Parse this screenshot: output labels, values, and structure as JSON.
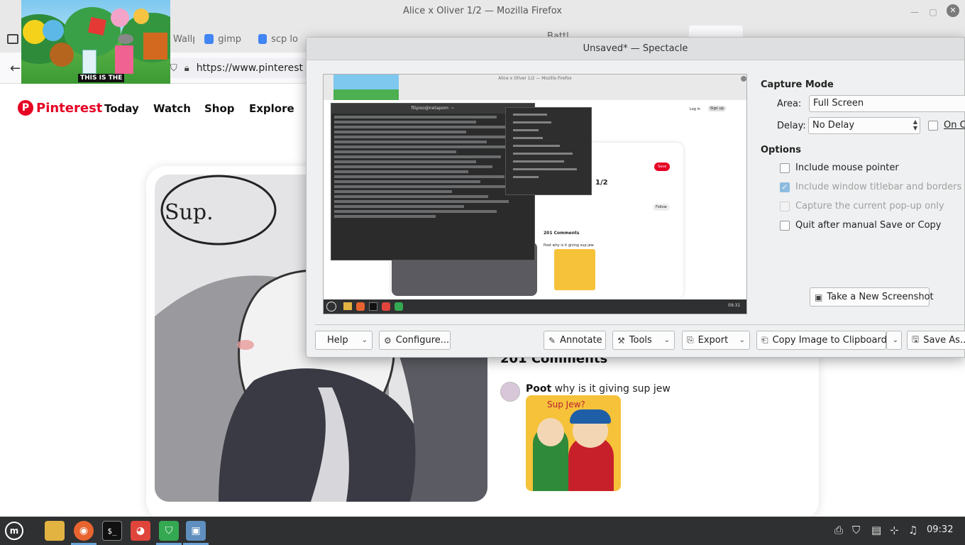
{
  "firefox": {
    "window_title": "Alice x Oliver 1/2 — Mozilla Firefox",
    "tabs": [
      {
        "label": "Wallp"
      },
      {
        "label": "gimp"
      },
      {
        "label": "scp lo"
      },
      {
        "label": "Battl"
      }
    ],
    "url": "https://www.pinterest",
    "thumbnail_caption": "THIS IS THE"
  },
  "pinterest": {
    "logo_text": "Pinterest",
    "nav": [
      "Today",
      "Watch",
      "Shop",
      "Explore"
    ],
    "speech_text": "Sup.",
    "comments_title": "201 Comments",
    "comment": {
      "author": "Poot",
      "text": "why is it giving sup jew"
    },
    "comment_image_text": "Sup Jew?"
  },
  "spectacle": {
    "title": "Unsaved* — Spectacle",
    "capture_mode_heading": "Capture Mode",
    "area_label": "Area:",
    "area_value": "Full Screen",
    "delay_label": "Delay:",
    "delay_value": "No Delay",
    "on_click_label": "On Cl",
    "options_heading": "Options",
    "options": [
      {
        "label": "Include mouse pointer",
        "checked": false,
        "enabled": true
      },
      {
        "label": "Include window titlebar and borders",
        "checked": true,
        "enabled": false
      },
      {
        "label": "Capture the current pop-up only",
        "checked": false,
        "enabled": false
      },
      {
        "label": "Quit after manual Save or Copy",
        "checked": false,
        "enabled": true
      }
    ],
    "take_screenshot_label": "Take a New Screenshot",
    "buttons": {
      "help": "Help",
      "configure": "Configure...",
      "annotate": "Annotate",
      "tools": "Tools",
      "export": "Export",
      "copy": "Copy Image to Clipboard",
      "save": "Save As..."
    },
    "preview": {
      "window_title": "Alice x Oliver 1/2 — Mozilla Firefox",
      "terminal_title": "filipiso@netapom: ~",
      "pin_title": "1/2",
      "follow": "Follow",
      "save": "Save",
      "comments": "201 Comments",
      "comment": "Poot why is it giving sup jew",
      "clock": "09:31",
      "login": "Log in",
      "signup": "Sign up"
    }
  },
  "taskbar": {
    "clock": "09:32"
  },
  "colors": {
    "pinterest_red": "#e60023",
    "taskbar_bg": "#2f3031",
    "checkbox_accent": "#4d9bd6"
  }
}
